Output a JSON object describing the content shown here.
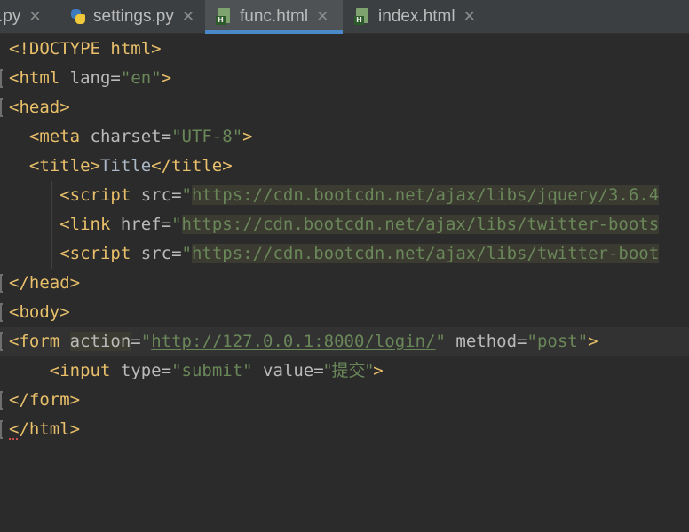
{
  "tabs": [
    {
      "name": ".py",
      "icon": "",
      "active": false
    },
    {
      "name": "settings.py",
      "icon": "python-file-icon",
      "active": false
    },
    {
      "name": "func.html",
      "icon": "html-file-icon",
      "active": true
    },
    {
      "name": "index.html",
      "icon": "html-file-icon",
      "active": false
    }
  ],
  "tab_close_glyph": "✕",
  "html_badge": "H",
  "colors": {
    "tag": "#e8bf6a",
    "attr": "#bababa",
    "string": "#6a8759",
    "text": "#a9b7c6",
    "accent": "#4a88c7"
  },
  "code": {
    "doctype": "<!DOCTYPE html>",
    "html_open": {
      "tag": "<html",
      "attr": "lang",
      "value": "\"en\"",
      "close": ">"
    },
    "head_open": "<head>",
    "meta": {
      "tag": "<meta",
      "attr": "charset",
      "value": "\"UTF-8\"",
      "close": ">"
    },
    "title": {
      "open": "<title>",
      "text": "Title",
      "close": "</title>"
    },
    "script1": {
      "tag": "<script",
      "attr": "src",
      "q": "\"",
      "url": "https://cdn.bootcdn.net/ajax/libs/jquery/3.6.4"
    },
    "link": {
      "tag": "<link",
      "attr": "href",
      "q": "\"",
      "url": "https://cdn.bootcdn.net/ajax/libs/twitter-boots"
    },
    "script2": {
      "tag": "<script",
      "attr": "src",
      "q": "\"",
      "url": "https://cdn.bootcdn.net/ajax/libs/twitter-boot"
    },
    "head_close": "</head>",
    "body_open": "<body>",
    "form_open": {
      "tag": "<form",
      "attr1": "action",
      "q": "\"",
      "url": "http://127.0.0.1:8000/login/",
      "attr2": "method",
      "value2": "\"post\"",
      "close": ">"
    },
    "input": {
      "tag": "<input",
      "attr1": "type",
      "value1": "\"submit\"",
      "attr2": "value",
      "value2": "\"提交\"",
      "close": ">"
    },
    "form_close": "</form>",
    "html_close": "</html>"
  }
}
